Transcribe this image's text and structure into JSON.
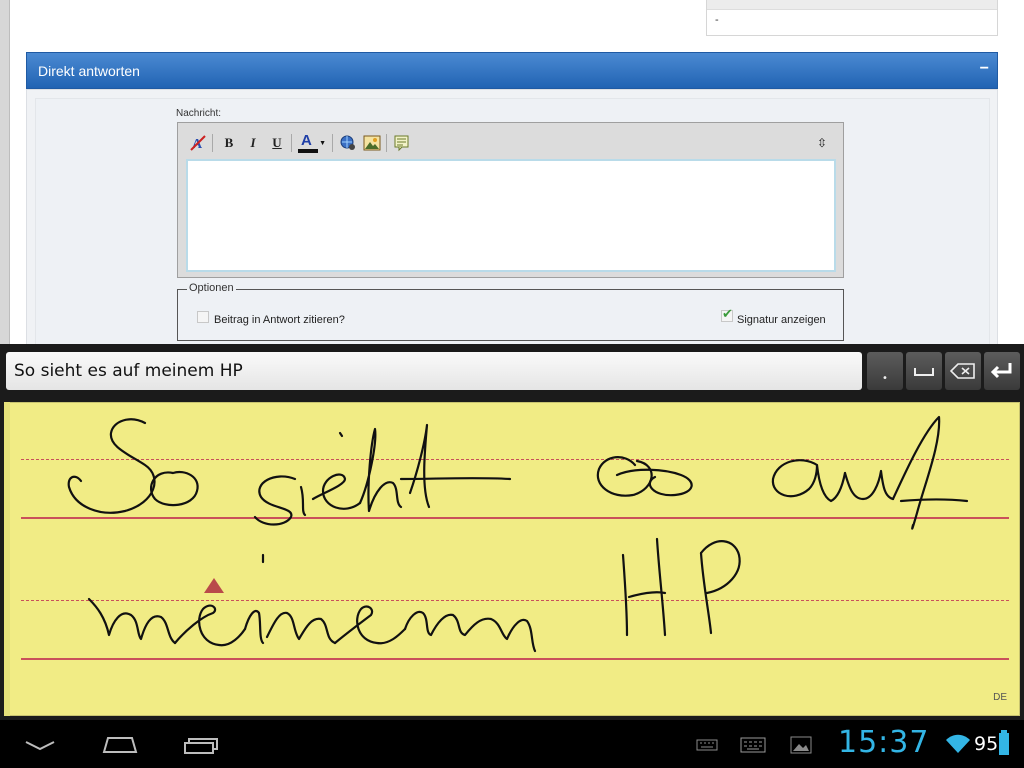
{
  "page": {
    "top_box_text": "-",
    "reply_panel": {
      "title": "Direkt antworten",
      "collapse_symbol": "−"
    },
    "message_label": "Nachricht:",
    "toolbar": {
      "bold": "B",
      "italic": "I",
      "underline": "U",
      "font_color": "A",
      "resize": "⇳"
    },
    "editor_value": "",
    "options": {
      "legend": "Optionen",
      "quote_label": "Beitrag in Antwort zitieren?",
      "quote_checked": false,
      "signature_label": "Signatur anzeigen",
      "signature_checked": true
    }
  },
  "ime": {
    "recognized_text": "So sieht es auf meinem HP",
    "keys": {
      "period": "•",
      "space": "␣",
      "backspace": "⌫",
      "enter": "↵"
    },
    "language": "DE"
  },
  "system_bar": {
    "clock": "15:37",
    "battery": "95",
    "accent_color": "#33b5e5"
  }
}
